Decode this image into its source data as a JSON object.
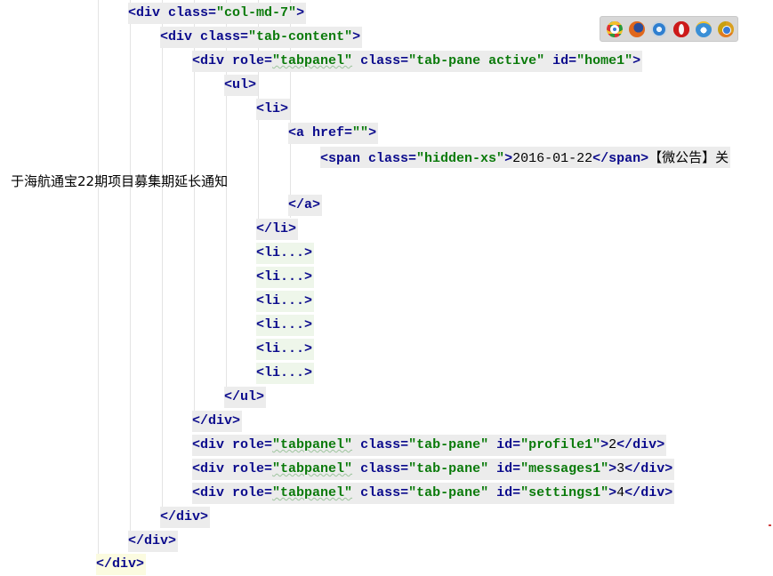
{
  "editor": {
    "lines": [
      {
        "open": "<",
        "tag": "div",
        "a1": " class=",
        "v1": "\"col-md-7\"",
        "close": ">"
      },
      {
        "open": "<",
        "tag": "div",
        "a1": " class=",
        "v1": "\"tab-content\"",
        "close": ">"
      },
      {
        "open": "<",
        "tag": "div",
        "a1": " role=",
        "v1": "\"tabpanel\"",
        "a2": " class=",
        "v2": "\"tab-pane active\"",
        "a3": " id=",
        "v3": "\"home1\"",
        "close": ">"
      },
      {
        "open": "<",
        "tag": "ul",
        "close": ">"
      },
      {
        "open": "<",
        "tag": "li",
        "close": ">"
      },
      {
        "open": "<",
        "tag": "a",
        "a1": " href=",
        "v1": "\"\"",
        "close": ">"
      },
      {
        "open": "<",
        "tag": "span",
        "a1": " class=",
        "v1": "\"hidden-xs\"",
        "close": ">",
        "text": "2016-01-22",
        "end_open": "</",
        "end_tag": "span",
        "end_close": ">",
        "text2": "【微公告】关"
      },
      {
        "text": "于海航通宝22期项目募集期延长通知"
      },
      {
        "open": "</",
        "tag": "a",
        "close": ">"
      },
      {
        "open": "</",
        "tag": "li",
        "close": ">"
      },
      {
        "open": "<",
        "tag": "li...",
        "close": ">"
      },
      {
        "open": "<",
        "tag": "li...",
        "close": ">"
      },
      {
        "open": "<",
        "tag": "li...",
        "close": ">"
      },
      {
        "open": "<",
        "tag": "li...",
        "close": ">"
      },
      {
        "open": "<",
        "tag": "li...",
        "close": ">"
      },
      {
        "open": "<",
        "tag": "li...",
        "close": ">"
      },
      {
        "open": "</",
        "tag": "ul",
        "close": ">"
      },
      {
        "open": "</",
        "tag": "div",
        "close": ">"
      },
      {
        "open": "<",
        "tag": "div",
        "a1": " role=",
        "v1": "\"tabpanel\"",
        "a2": " class=",
        "v2": "\"tab-pane\"",
        "a3": " id=",
        "v3": "\"profile1\"",
        "close": ">",
        "text": "2",
        "end_open": "</",
        "end_tag": "div",
        "end_close": ">"
      },
      {
        "open": "<",
        "tag": "div",
        "a1": " role=",
        "v1": "\"tabpanel\"",
        "a2": " class=",
        "v2": "\"tab-pane\"",
        "a3": " id=",
        "v3": "\"messages1\"",
        "close": ">",
        "text": "3",
        "end_open": "</",
        "end_tag": "div",
        "end_close": ">"
      },
      {
        "open": "<",
        "tag": "div",
        "a1": " role=",
        "v1": "\"tabpanel\"",
        "a2": " class=",
        "v2": "\"tab-pane\"",
        "a3": " id=",
        "v3": "\"settings1\"",
        "close": ">",
        "text": "4",
        "end_open": "</",
        "end_tag": "div",
        "end_close": ">"
      },
      {
        "open": "</",
        "tag": "div",
        "close": ">"
      },
      {
        "open": "</",
        "tag": "div",
        "close": ">"
      },
      {
        "open": "</",
        "tag": "div",
        "close": ">"
      }
    ]
  },
  "browser_preview": {
    "icons": [
      "chrome-icon",
      "firefox-icon",
      "safari-icon",
      "opera-icon",
      "internet-explorer-icon",
      "chrome-canary-icon"
    ],
    "colors": [
      "#4a8a3a",
      "#e0671c",
      "#2f7fd0",
      "#cc1a1a",
      "#3a8fd6",
      "#d9a020"
    ]
  }
}
